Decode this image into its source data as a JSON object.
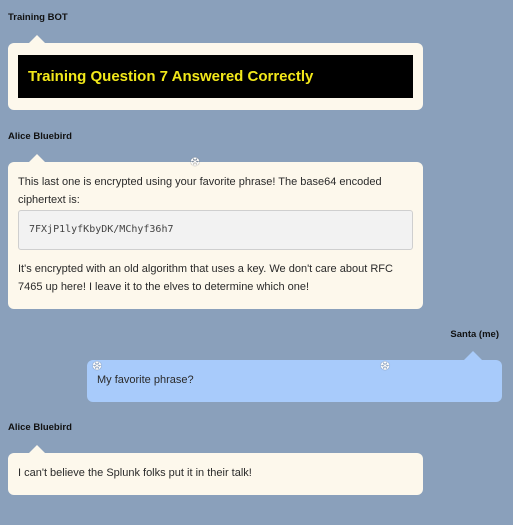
{
  "messages": [
    {
      "sender": "Training BOT",
      "banner": "Training Question 7 Answered Correctly"
    },
    {
      "sender": "Alice Bluebird",
      "text_before": "This last one is encrypted using your favorite phrase! The base64 encoded ciphertext is:",
      "code": "7FXjP1lyfKbyDK/MChyf36h7",
      "text_after": "It's encrypted with an old algorithm that uses a key. We don't care about RFC 7465 up here! I leave it to the elves to determine which one!"
    },
    {
      "sender": "Santa (me)",
      "text": "My favorite phrase?"
    },
    {
      "sender": "Alice Bluebird",
      "text": "I can't believe the Splunk folks put it in their talk!"
    }
  ],
  "decorations": {
    "snowflake_glyph": "❆"
  },
  "colors": {
    "background": "#8aa0bb",
    "bubble_other": "#fdf8ec",
    "bubble_me": "#a8cbfb",
    "banner_bg": "#000000",
    "banner_text": "#f2e81a"
  }
}
